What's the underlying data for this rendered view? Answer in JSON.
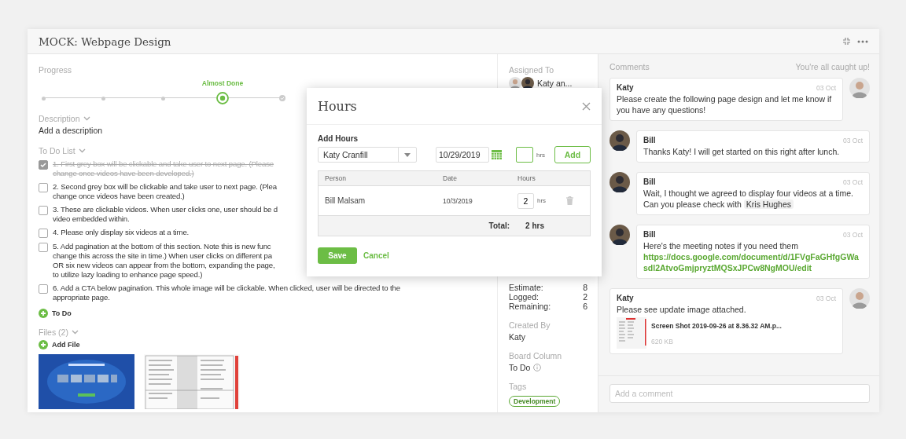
{
  "window": {
    "title": "MOCK: Webpage Design"
  },
  "progress": {
    "label": "Progress",
    "steps": [
      {
        "kind": "step",
        "selected": false
      },
      {
        "kind": "step",
        "selected": false
      },
      {
        "kind": "step",
        "selected": false
      },
      {
        "kind": "step",
        "selected": true,
        "label": "Almost Done"
      },
      {
        "kind": "final",
        "selected": false
      }
    ]
  },
  "description": {
    "label": "Description",
    "value": "Add a description"
  },
  "todo": {
    "label": "To Do List",
    "add_label": "To Do",
    "items": [
      {
        "checked": true,
        "lines": [
          "1. First grey box will be clickable and take user to next page. (Please",
          "change once videos have been developed.)"
        ]
      },
      {
        "checked": false,
        "lines": [
          "2. Second grey box will be clickable and take user to next page. (Plea",
          "change once videos have been created.)"
        ]
      },
      {
        "checked": false,
        "lines": [
          "3. These are clickable videos. When user clicks one, user should be d",
          "video embedded within."
        ]
      },
      {
        "checked": false,
        "lines": [
          "4. Please only display six videos at a time."
        ]
      },
      {
        "checked": false,
        "lines": [
          "5. Add pagination at the bottom of this section. Note this is new func",
          "change this across the site in time.) When user clicks on different pa",
          "OR six new videos can appear from the bottom, expanding the page,",
          "to utilize lazy loading to enhance page speed.)"
        ]
      },
      {
        "checked": false,
        "lines": [
          "6. Add a CTA below pagination. This whole image will be clickable. When clicked, user will be directed to the",
          "appropriate page."
        ]
      }
    ]
  },
  "files": {
    "label": "Files (2)",
    "add_label": "Add File"
  },
  "details": {
    "assigned": {
      "label": "Assigned To",
      "value": "Katy an..."
    },
    "time": [
      {
        "label": "Estimate:",
        "value": "8"
      },
      {
        "label": "Logged:",
        "value": "2"
      },
      {
        "label": "Remaining:",
        "value": "6"
      }
    ],
    "created_by": {
      "label": "Created By",
      "value": "Katy"
    },
    "board_column": {
      "label": "Board Column",
      "value": "To Do"
    },
    "tags": {
      "label": "Tags",
      "items": [
        "Development"
      ]
    }
  },
  "comments": {
    "title": "Comments",
    "status": "You're all caught up!",
    "placeholder": "Add a comment",
    "items": [
      {
        "kind": "outgoing",
        "author": "Katy",
        "date": "03 Oct",
        "body": "Please create the following page design and let me know if you have any questions!"
      },
      {
        "kind": "incoming",
        "author": "Bill",
        "date": "03 Oct",
        "body": "Thanks Katy! I will get started on this right after lunch."
      },
      {
        "kind": "incoming",
        "author": "Bill",
        "date": "03 Oct",
        "body": "Wait, I thought we agreed to display four videos at a time. Can you please check with",
        "mention": "Kris Hughes"
      },
      {
        "kind": "incoming",
        "author": "Bill",
        "date": "03 Oct",
        "body": "Here's the meeting notes if you need them",
        "link": "https://docs.google.com/document/d/1FVgFaGHfgGWasdl2AtvoGmjpryztMQSxJPCw8NgMOU/edit"
      },
      {
        "kind": "outgoing",
        "author": "Katy",
        "date": "03 Oct",
        "body": "Please see update image attached.",
        "attachment": {
          "name": "Screen Shot 2019-09-26 at 8.36.32 AM.p...",
          "size": "620 KB"
        }
      }
    ]
  },
  "modal": {
    "title": "Hours",
    "section": "Add Hours",
    "person": "Katy Cranfill",
    "date": "10/29/2019",
    "unit": "hrs",
    "add": "Add",
    "columns": [
      "Person",
      "Date",
      "Hours"
    ],
    "rows": [
      {
        "person": "Bill Malsam",
        "date": "10/3/2019",
        "hours": "2",
        "unit": "hrs"
      }
    ],
    "total_label": "Total:",
    "total": "2 hrs",
    "save": "Save",
    "cancel": "Cancel"
  }
}
